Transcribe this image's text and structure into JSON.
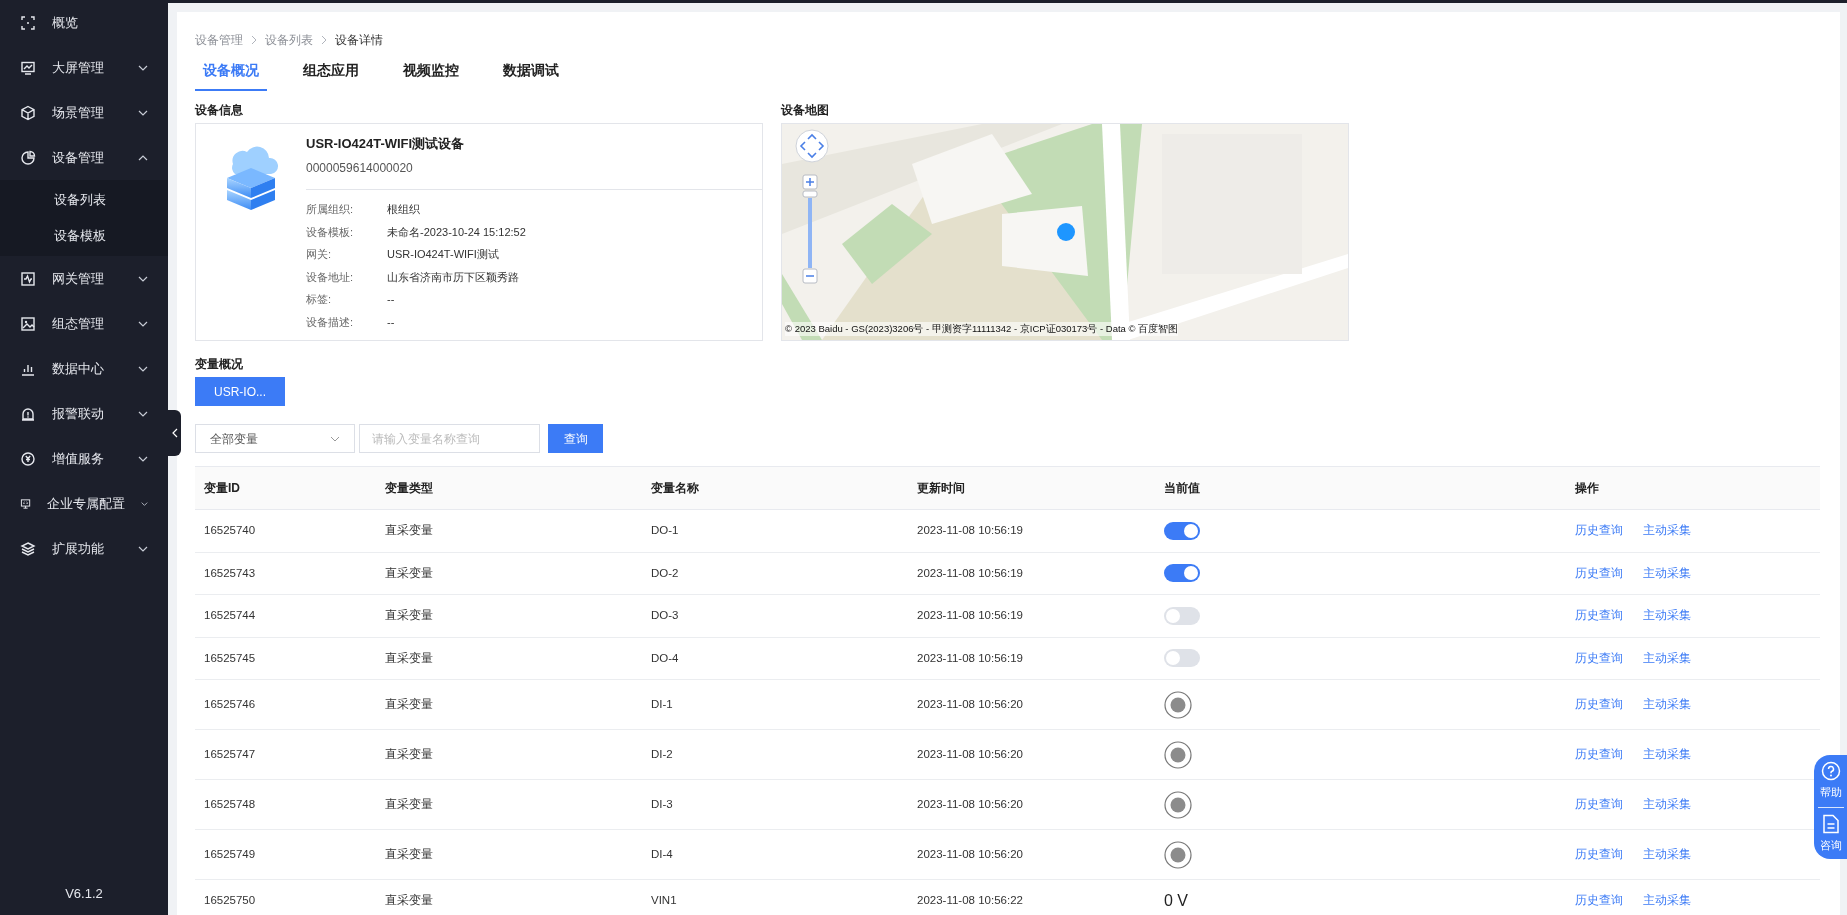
{
  "sidebar": {
    "items": [
      {
        "label": "概览"
      },
      {
        "label": "大屏管理",
        "expanded": false
      },
      {
        "label": "场景管理",
        "expanded": false
      },
      {
        "label": "设备管理",
        "expanded": true,
        "children": [
          {
            "label": "设备列表",
            "selected": false
          },
          {
            "label": "设备模板",
            "selected": false
          }
        ]
      },
      {
        "label": "网关管理",
        "expanded": false
      },
      {
        "label": "组态管理",
        "expanded": false
      },
      {
        "label": "数据中心",
        "expanded": false
      },
      {
        "label": "报警联动",
        "expanded": false
      },
      {
        "label": "增值服务",
        "expanded": false
      },
      {
        "label": "企业专属配置",
        "expanded": false
      },
      {
        "label": "扩展功能",
        "expanded": false
      }
    ],
    "version": "V6.1.2"
  },
  "breadcrumb": [
    "设备管理",
    "设备列表",
    "设备详情"
  ],
  "tabs": [
    {
      "label": "设备概况",
      "selected": true
    },
    {
      "label": "组态应用",
      "selected": false
    },
    {
      "label": "视频监控",
      "selected": false
    },
    {
      "label": "数据调试",
      "selected": false
    }
  ],
  "device_info": {
    "heading": "设备信息",
    "name": "USR-IO424T-WIFI测试设备",
    "serial": "0000059614000020",
    "fields": [
      {
        "label": "所属组织:",
        "value": "根组织"
      },
      {
        "label": "设备模板:",
        "value": "未命名-2023-10-24 15:12:52"
      },
      {
        "label": "网关:",
        "value": "USR-IO424T-WIFI测试"
      },
      {
        "label": "设备地址:",
        "value": "山东省济南市历下区颖秀路"
      },
      {
        "label": "标签:",
        "value": "--"
      },
      {
        "label": "设备描述:",
        "value": "--"
      }
    ]
  },
  "device_map": {
    "heading": "设备地图",
    "kind": "picture",
    "attribution": "© 2023 Baidu - GS(2023)3206号 - 甲测资字11111342 - 京ICP证030173号 - Data © 百度智图"
  },
  "variables": {
    "heading": "变量概况",
    "gateway_button": "USR-IO...",
    "filter_select": "全部变量",
    "search_placeholder": "请输入变量名称查询",
    "query_button": "查询"
  },
  "table": {
    "columns": [
      "变量ID",
      "变量类型",
      "变量名称",
      "更新时间",
      "当前值",
      "操作"
    ],
    "rows": [
      {
        "id": "16525740",
        "type": "直采变量",
        "name": "DO-1",
        "time": "2023-11-08 10:56:19",
        "kind": "switch",
        "on": true,
        "actions": [
          "历史查询",
          "主动采集"
        ]
      },
      {
        "id": "16525743",
        "type": "直采变量",
        "name": "DO-2",
        "time": "2023-11-08 10:56:19",
        "kind": "switch",
        "on": true,
        "actions": [
          "历史查询",
          "主动采集"
        ]
      },
      {
        "id": "16525744",
        "type": "直采变量",
        "name": "DO-3",
        "time": "2023-11-08 10:56:19",
        "kind": "switch",
        "on": false,
        "actions": [
          "历史查询",
          "主动采集"
        ]
      },
      {
        "id": "16525745",
        "type": "直采变量",
        "name": "DO-4",
        "time": "2023-11-08 10:56:19",
        "kind": "switch",
        "on": false,
        "actions": [
          "历史查询",
          "主动采集"
        ]
      },
      {
        "id": "16525746",
        "type": "直采变量",
        "name": "DI-1",
        "time": "2023-11-08 10:56:20",
        "kind": "indicator",
        "actions": [
          "历史查询",
          "主动采集"
        ]
      },
      {
        "id": "16525747",
        "type": "直采变量",
        "name": "DI-2",
        "time": "2023-11-08 10:56:20",
        "kind": "indicator",
        "actions": [
          "历史查询",
          "主动采集"
        ]
      },
      {
        "id": "16525748",
        "type": "直采变量",
        "name": "DI-3",
        "time": "2023-11-08 10:56:20",
        "kind": "indicator",
        "actions": [
          "历史查询",
          "主动采集"
        ]
      },
      {
        "id": "16525749",
        "type": "直采变量",
        "name": "DI-4",
        "time": "2023-11-08 10:56:20",
        "kind": "indicator",
        "actions": [
          "历史查询",
          "主动采集"
        ]
      },
      {
        "id": "16525750",
        "type": "直采变量",
        "name": "VIN1",
        "time": "2023-11-08 10:56:22",
        "kind": "text",
        "value": "0 V",
        "actions": [
          "历史查询",
          "主动采集"
        ]
      }
    ]
  },
  "float_panel": [
    {
      "label": "帮助"
    },
    {
      "label": "咨询"
    }
  ]
}
